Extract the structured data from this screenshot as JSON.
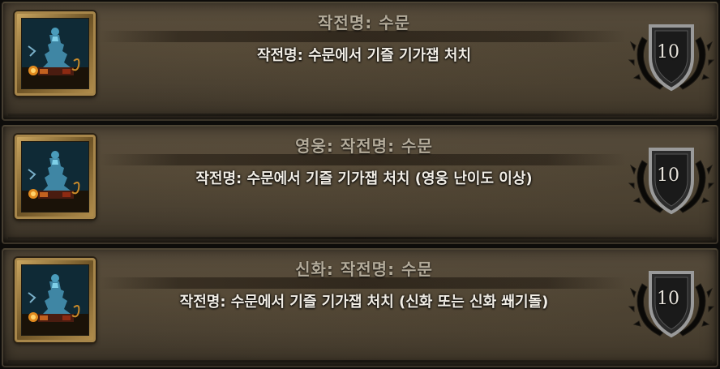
{
  "achievements": [
    {
      "title": "작전명: 수문",
      "description": "작전명: 수문에서 기즐 기가잽 처치",
      "points": "10",
      "icon": "mechagon-icon"
    },
    {
      "title": "영웅: 작전명: 수문",
      "description": "작전명: 수문에서 기즐 기가잽 처치 (영웅 난이도 이상)",
      "points": "10",
      "icon": "mechagon-icon"
    },
    {
      "title": "신화: 작전명: 수문",
      "description": "작전명: 수문에서 기즐 기가잽 처치 (신화 또는 신화 쐐기돌)",
      "points": "10",
      "icon": "mechagon-icon"
    }
  ],
  "colors": {
    "title": "#b3ab9a",
    "description": "#f2eee6",
    "frame_gold": "#a7864a"
  }
}
